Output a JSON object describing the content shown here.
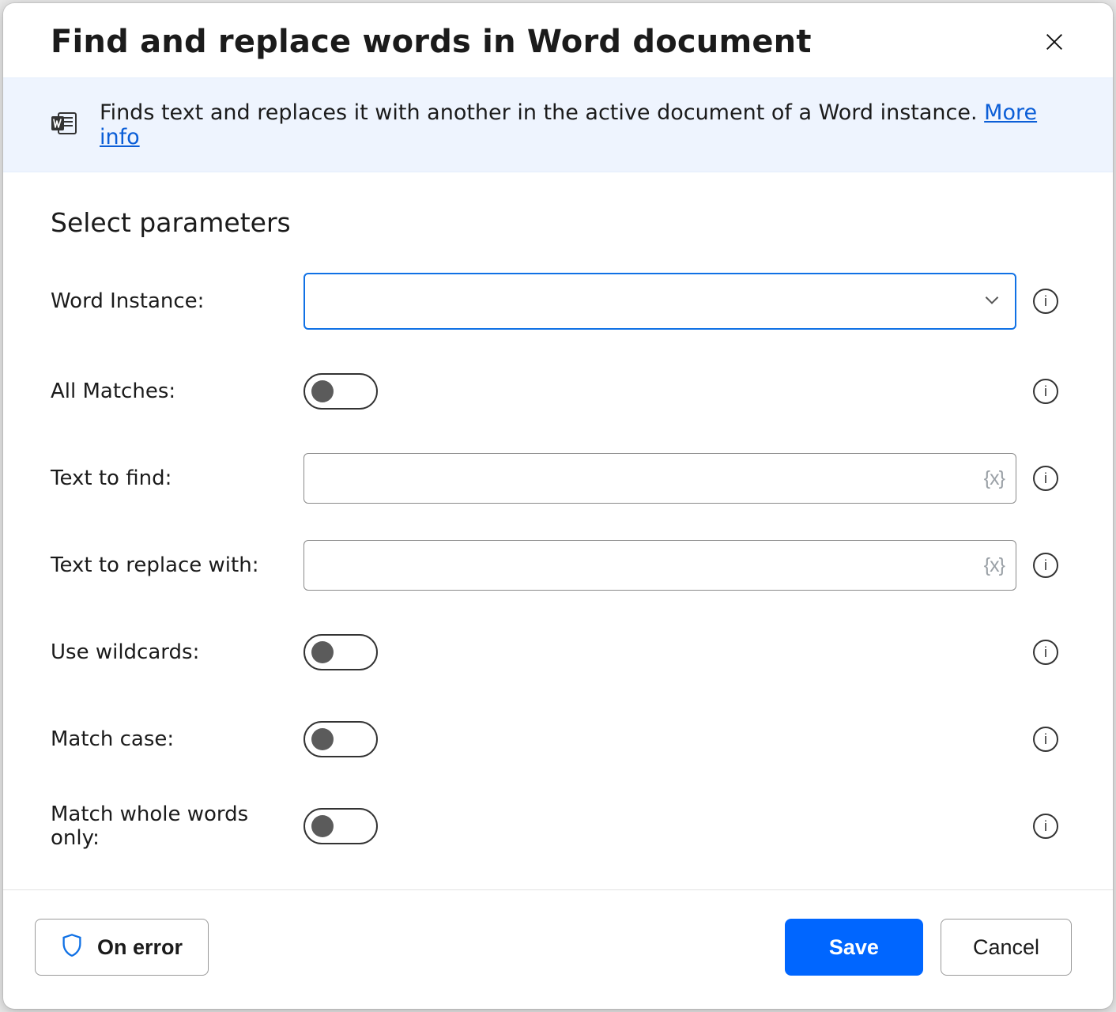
{
  "header": {
    "title": "Find and replace words in Word document"
  },
  "banner": {
    "text": "Finds text and replaces it with another in the active document of a Word instance. ",
    "link_text": "More info"
  },
  "section_title": "Select parameters",
  "params": {
    "word_instance": {
      "label": "Word Instance:",
      "value": ""
    },
    "all_matches": {
      "label": "All Matches:"
    },
    "text_to_find": {
      "label": "Text to find:",
      "value": "",
      "var_icon": "{x}"
    },
    "text_to_replace": {
      "label": "Text to replace with:",
      "value": "",
      "var_icon": "{x}"
    },
    "use_wildcards": {
      "label": "Use wildcards:"
    },
    "match_case": {
      "label": "Match case:"
    },
    "match_whole": {
      "label": "Match whole words only:"
    }
  },
  "footer": {
    "on_error_label": "On error",
    "save_label": "Save",
    "cancel_label": "Cancel"
  },
  "info_char": "i"
}
